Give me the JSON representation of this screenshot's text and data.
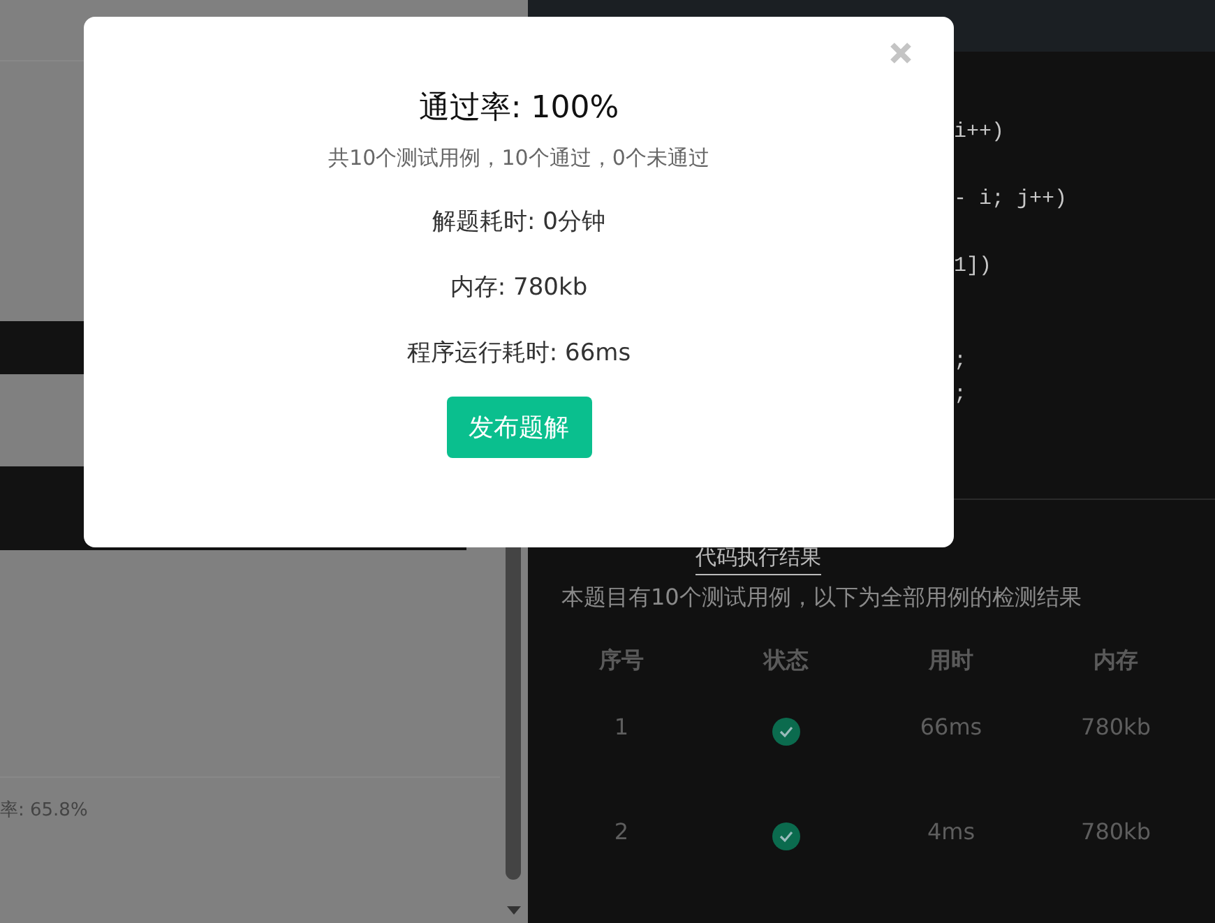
{
  "left_panel": {
    "pass_rate_text": "率: 65.8%"
  },
  "code_lines": [
    "i++)",
    "- i; j++)",
    "1])",
    ";",
    ";"
  ],
  "result_tabs": [
    {
      "label": "代码执行结果",
      "selected": true
    }
  ],
  "result_summary": "本题目有10个测试用例，以下为全部用例的检测结果",
  "table": {
    "columns": [
      "序号",
      "状态",
      "用时",
      "内存"
    ],
    "rows": [
      {
        "index": "1",
        "passed": true,
        "time": "66ms",
        "memory": "780kb"
      },
      {
        "index": "2",
        "passed": true,
        "time": "4ms",
        "memory": "780kb"
      }
    ]
  },
  "dialog": {
    "title": "通过率: 100%",
    "subtitle": "共10个测试用例，10个通过，0个未通过",
    "stats": [
      "解题耗时: 0分钟",
      "内存: 780kb",
      "程序运行耗时: 66ms"
    ],
    "button": "发布题解"
  }
}
